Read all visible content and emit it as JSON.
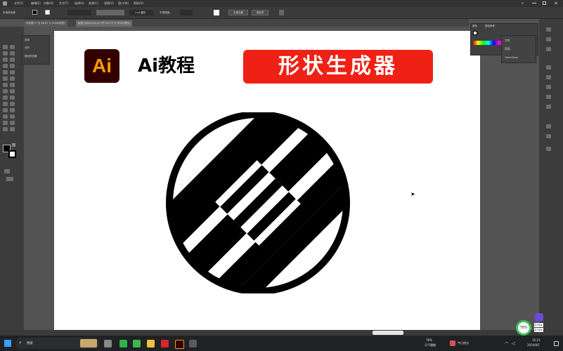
{
  "menubar": {
    "items": [
      "文件(F)",
      "编辑(E)",
      "对象(O)",
      "文字(T)",
      "选择(S)",
      "效果(C)",
      "视图(V)",
      "窗口(W)",
      "帮助(H)"
    ]
  },
  "control_bar": {
    "selection_label": "未选择对象",
    "opacity_label": "不透明度",
    "stroke_value": "1 pt 圆形",
    "doc_setup_button": "文档设置",
    "preferences_button": "首选项"
  },
  "tabs": [
    {
      "label": "未标题-1* @ 66.67 % (RGB/预览)"
    },
    {
      "label": "新建 (800x500).ai* @ 129.77 % (RGB/预览)"
    }
  ],
  "float_panel": {
    "items": [
      "变换",
      "对齐",
      "路径查找器"
    ]
  },
  "panel_menu": {
    "items": [
      "字符",
      "段落",
      "OpenType"
    ]
  },
  "panel_top": {
    "tab1": "颜色",
    "tab2": "颜色参考"
  },
  "artboard": {
    "logo_text": "Ai",
    "heading": "Ai教程",
    "banner": "形状生成器"
  },
  "taskbar": {
    "search_placeholder": "搜索",
    "weather_temp": "78%",
    "weather_desc": "天气晴朗",
    "news": "今日热点",
    "time": "15:21",
    "date": "2024/8/1",
    "badge_percent": "78%",
    "badge_speed1": "0.5k/s",
    "badge_speed2": "0.3k/s"
  },
  "colors": {
    "accent_red": "#ef2115",
    "ai_orange": "#ff9a00",
    "ai_bg": "#330000",
    "ui_dark": "#3c3c3c"
  }
}
